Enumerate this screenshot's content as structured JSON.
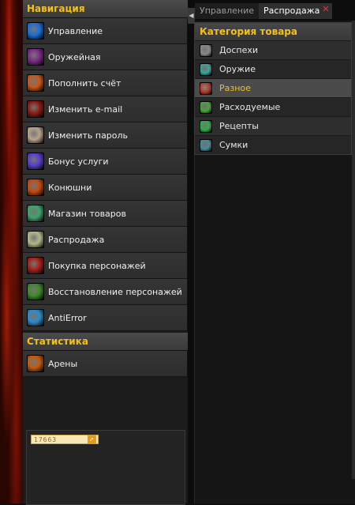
{
  "sidebar": {
    "navigation_header": "Навигация",
    "items": [
      {
        "label": "Управление",
        "icon": "controls-icon",
        "color": "#1c6fd6"
      },
      {
        "label": "Оружейная",
        "icon": "crossed-swords-icon",
        "color": "#7a2a86"
      },
      {
        "label": "Пополнить счёт",
        "icon": "coin-deposit-icon",
        "color": "#c8571a"
      },
      {
        "label": "Изменить e-mail",
        "icon": "mail-icon",
        "color": "#8a1c14"
      },
      {
        "label": "Изменить пароль",
        "icon": "face-mask-icon",
        "color": "#b8a48c"
      },
      {
        "label": "Бонус услуги",
        "icon": "bonus-blade-icon",
        "color": "#5a3ec8"
      },
      {
        "label": "Конюшни",
        "icon": "mount-icon",
        "color": "#c44a10"
      },
      {
        "label": "Магазин товаров",
        "icon": "orb-shop-icon",
        "color": "#3fa36a"
      },
      {
        "label": "Распродажа",
        "icon": "potion-sale-icon",
        "color": "#b6b88a"
      },
      {
        "label": "Покупка персонажей",
        "icon": "demon-character-icon",
        "color": "#a3201a"
      },
      {
        "label": "Восстановление персонажей",
        "icon": "restore-hand-icon",
        "color": "#3e8a2a"
      },
      {
        "label": "AntiError",
        "icon": "vortex-icon",
        "color": "#2f8ac8"
      }
    ],
    "statistics_header": "Статистика",
    "stats_items": [
      {
        "label": "Арены",
        "icon": "arena-icon",
        "color": "#c05a12"
      }
    ],
    "counter": {
      "value": "17663",
      "arrow": "↗"
    }
  },
  "tabs": [
    {
      "label": "Управление",
      "active": false
    },
    {
      "label": "Распродажа",
      "active": true
    }
  ],
  "tab_close_symbol": "✕",
  "collapse_symbol": "◀",
  "category_panel": {
    "header": "Категория товара",
    "items": [
      {
        "label": "Доспехи",
        "icon": "armor-icon",
        "color": "#8a8a8a",
        "selected": false
      },
      {
        "label": "Оружие",
        "icon": "sword-icon",
        "color": "#3fa39a",
        "selected": false
      },
      {
        "label": "Разное",
        "icon": "misc-icon",
        "color": "#b33a2a",
        "selected": true
      },
      {
        "label": "Расходуемые",
        "icon": "consumable-icon",
        "color": "#4aa63a",
        "selected": false
      },
      {
        "label": "Рецепты",
        "icon": "recipe-icon",
        "color": "#2fae4a",
        "selected": false
      },
      {
        "label": "Сумки",
        "icon": "bag-icon",
        "color": "#4a8a9a",
        "selected": false
      }
    ]
  }
}
